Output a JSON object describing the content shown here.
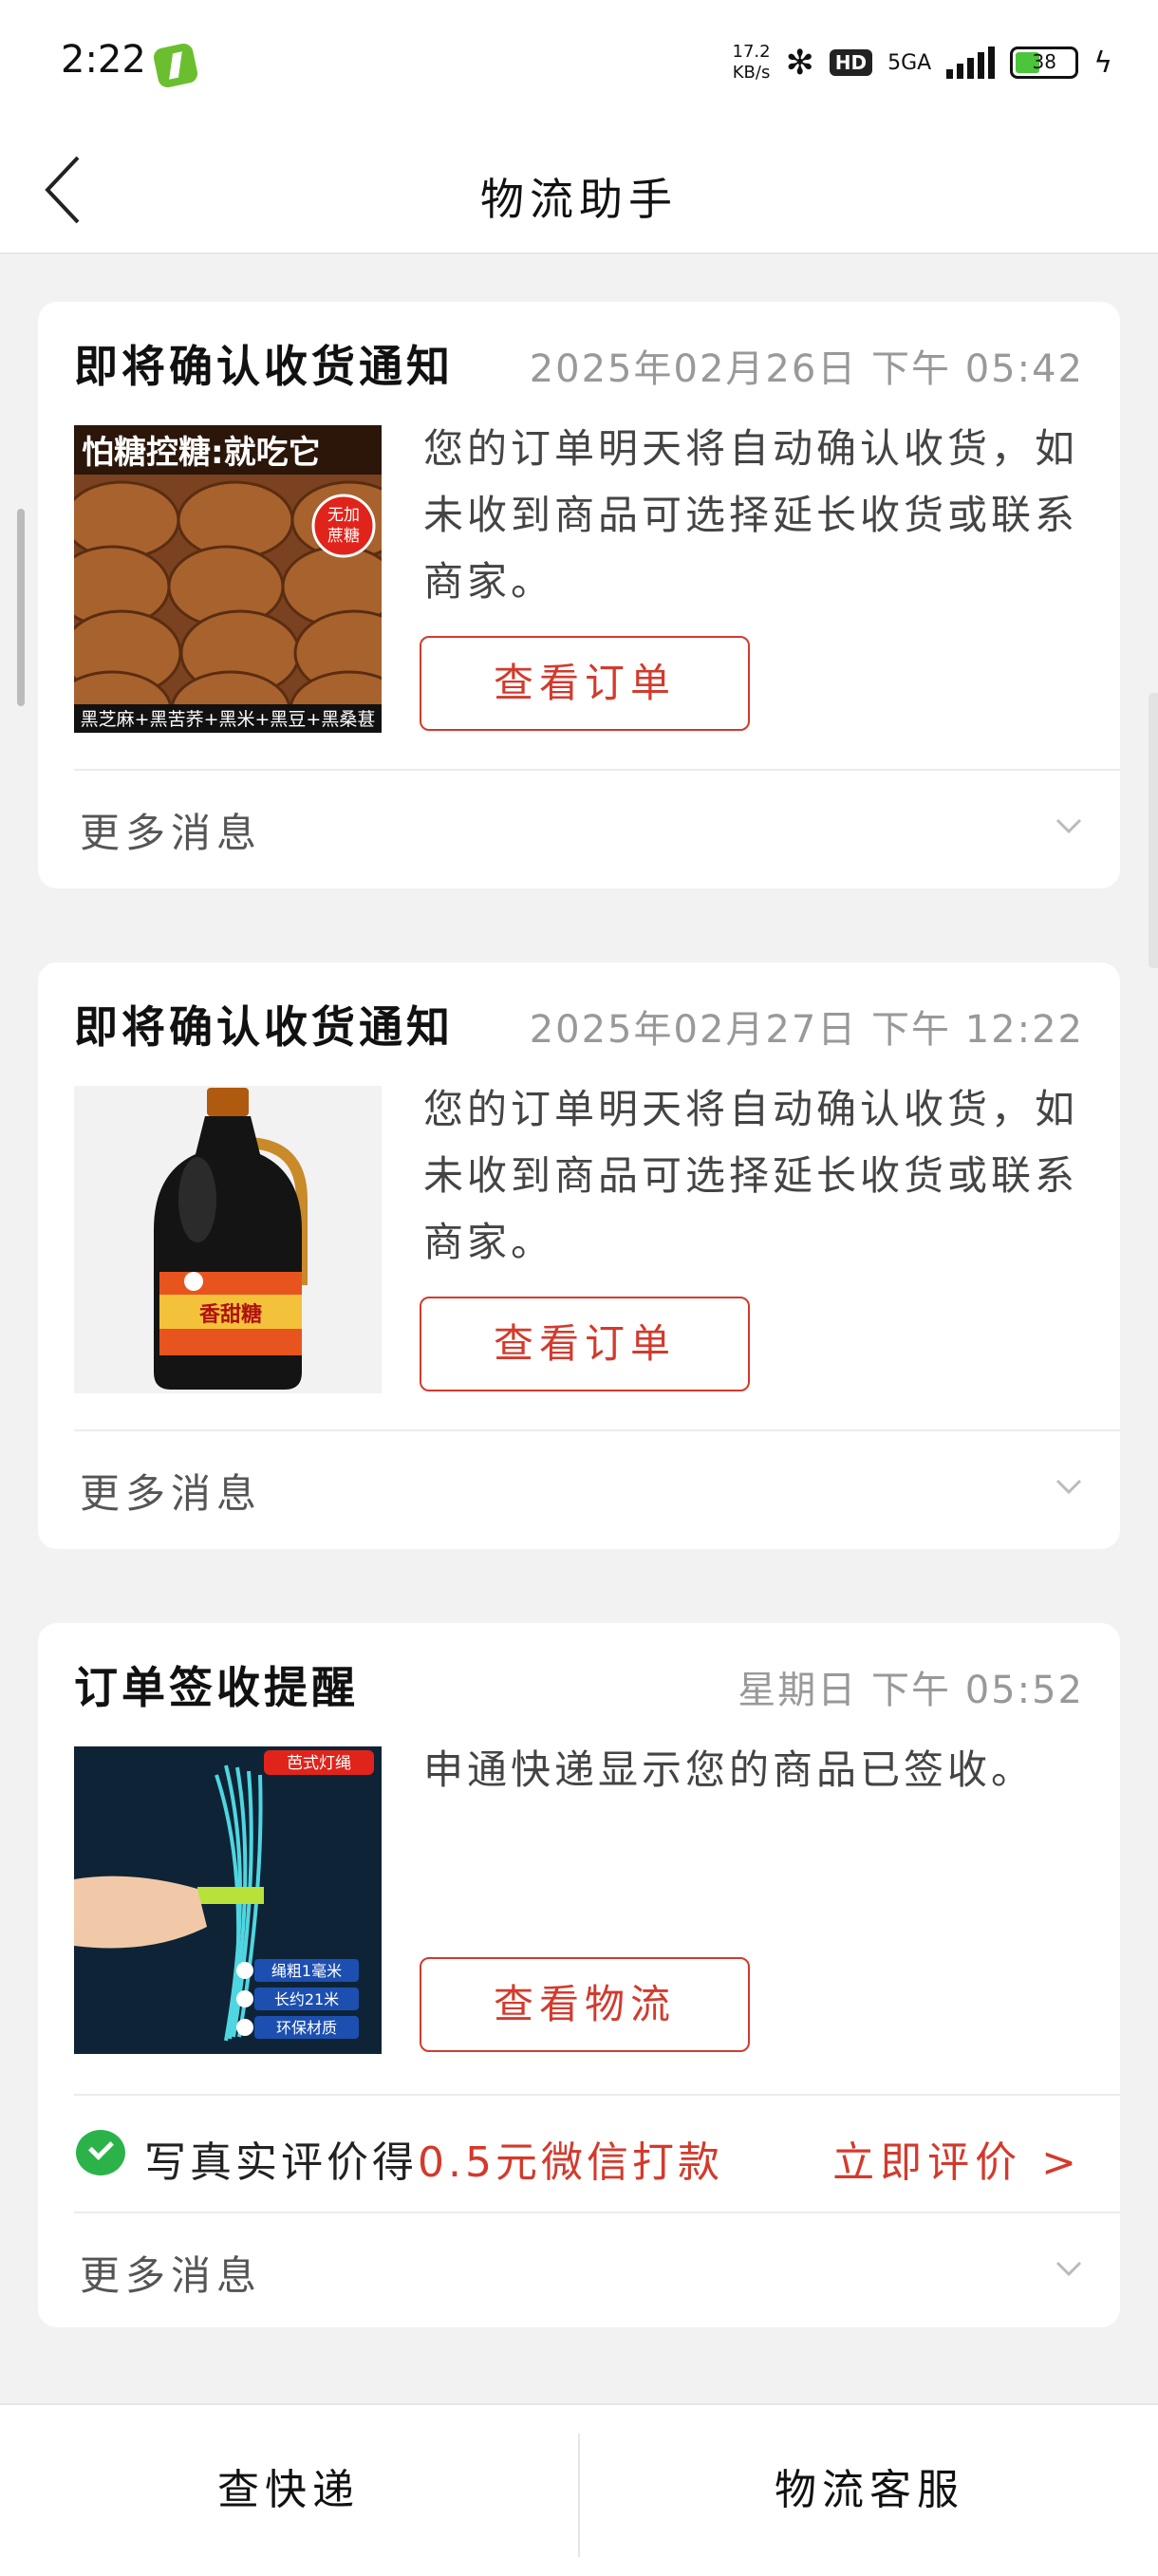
{
  "status_bar": {
    "time": "2:22",
    "net_speed_value": "17.2",
    "net_speed_unit": "KB/s",
    "hd": "HD",
    "network": "5GA",
    "battery": "38"
  },
  "nav": {
    "title": "物流助手"
  },
  "cards": [
    {
      "title": "即将确认收货通知",
      "time": "2025年02月26日 下午 05:42",
      "message": "您的订单明天将自动确认收货，如未收到商品可选择延长收货或联系商家。",
      "button": "查看订单",
      "more": "更多消息",
      "image": {
        "headline": "怕糖控糖:就吃它",
        "badge_line1": "无加",
        "badge_line2": "蔗糖",
        "ingredients": "黑芝麻+黑苦荞+黑米+黑豆+黑桑葚"
      }
    },
    {
      "title": "即将确认收货通知",
      "time": "2025年02月27日 下午 12:22",
      "message": "您的订单明天将自动确认收货，如未收到商品可选择延长收货或联系商家。",
      "button": "查看订单",
      "more": "更多消息",
      "image": {
        "label": "香甜糖"
      }
    },
    {
      "title": "订单签收提醒",
      "time": "星期日 下午 05:52",
      "message": "申通快递显示您的商品已签收。",
      "button": "查看物流",
      "more": "更多消息",
      "image": {
        "tag": "芭式灯绳",
        "feature1": "绳粗1毫米",
        "feature2": "长约21米",
        "feature3": "环保材质"
      },
      "review": {
        "prefix": "写真实评价得",
        "reward": "0.5元微信打款",
        "link": "立即评价 >"
      }
    }
  ],
  "bottom_bar": {
    "left": "查快递",
    "right": "物流客服"
  },
  "colors": {
    "accent": "#d33a2c",
    "wechat_green": "#2bb34a",
    "battery_green": "#4cc43b"
  }
}
